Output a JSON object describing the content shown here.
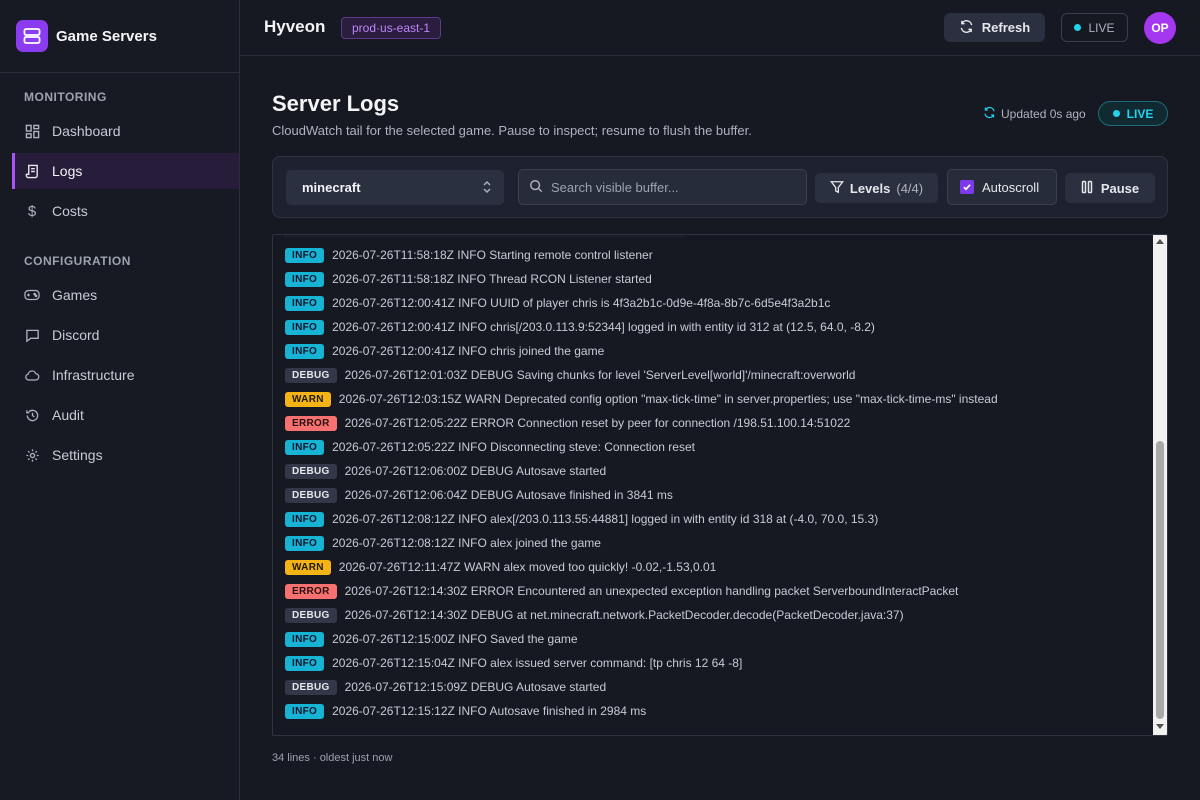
{
  "brand": {
    "name": "Game Servers"
  },
  "sidebar": {
    "sections": [
      {
        "label": "MONITORING"
      },
      {
        "label": "CONFIGURATION"
      }
    ],
    "items": [
      {
        "label": "Dashboard",
        "icon": "dashboard-icon"
      },
      {
        "label": "Logs",
        "icon": "logs-icon",
        "active": true
      },
      {
        "label": "Costs",
        "icon": "dollar-icon"
      },
      {
        "label": "Games",
        "icon": "gamepad-icon"
      },
      {
        "label": "Discord",
        "icon": "chat-icon"
      },
      {
        "label": "Infrastructure",
        "icon": "cloud-icon"
      },
      {
        "label": "Audit",
        "icon": "history-icon"
      },
      {
        "label": "Settings",
        "icon": "gear-icon"
      }
    ]
  },
  "topbar": {
    "title": "Hyveon",
    "env": "prod·us-east-1",
    "refresh_label": "Refresh",
    "live_label": "LIVE",
    "avatar_initials": "OP"
  },
  "header": {
    "title": "Server Logs",
    "subtitle": "CloudWatch tail for the selected game. Pause to inspect; resume to flush the buffer.",
    "updated": "Updated 0s ago",
    "live_label": "LIVE"
  },
  "toolbar": {
    "game": "minecraft",
    "search_placeholder": "Search visible buffer...",
    "levels_label": "Levels",
    "levels_count": "(4/4)",
    "autoscroll_label": "Autoscroll",
    "autoscroll_checked": true,
    "pause_label": "Pause"
  },
  "logs": [
    {
      "level": "INFO",
      "text": "2026-07-26T11:58:18Z INFO Starting remote control listener"
    },
    {
      "level": "INFO",
      "text": "2026-07-26T11:58:18Z INFO Thread RCON Listener started"
    },
    {
      "level": "INFO",
      "text": "2026-07-26T12:00:41Z INFO UUID of player chris is 4f3a2b1c-0d9e-4f8a-8b7c-6d5e4f3a2b1c"
    },
    {
      "level": "INFO",
      "text": "2026-07-26T12:00:41Z INFO chris[/203.0.113.9:52344] logged in with entity id 312 at (12.5, 64.0, -8.2)"
    },
    {
      "level": "INFO",
      "text": "2026-07-26T12:00:41Z INFO chris joined the game"
    },
    {
      "level": "DEBUG",
      "text": "2026-07-26T12:01:03Z DEBUG Saving chunks for level 'ServerLevel[world]'/minecraft:overworld"
    },
    {
      "level": "WARN",
      "text": "2026-07-26T12:03:15Z WARN Deprecated config option \"max-tick-time\" in server.properties; use \"max-tick-time-ms\" instead"
    },
    {
      "level": "ERROR",
      "text": "2026-07-26T12:05:22Z ERROR Connection reset by peer for connection /198.51.100.14:51022"
    },
    {
      "level": "INFO",
      "text": "2026-07-26T12:05:22Z INFO Disconnecting steve: Connection reset"
    },
    {
      "level": "DEBUG",
      "text": "2026-07-26T12:06:00Z DEBUG Autosave started"
    },
    {
      "level": "DEBUG",
      "text": "2026-07-26T12:06:04Z DEBUG Autosave finished in 3841 ms"
    },
    {
      "level": "INFO",
      "text": "2026-07-26T12:08:12Z INFO alex[/203.0.113.55:44881] logged in with entity id 318 at (-4.0, 70.0, 15.3)"
    },
    {
      "level": "INFO",
      "text": "2026-07-26T12:08:12Z INFO alex joined the game"
    },
    {
      "level": "WARN",
      "text": "2026-07-26T12:11:47Z WARN alex moved too quickly! -0.02,-1.53,0.01"
    },
    {
      "level": "ERROR",
      "text": "2026-07-26T12:14:30Z ERROR Encountered an unexpected exception handling packet ServerboundInteractPacket"
    },
    {
      "level": "DEBUG",
      "text": "2026-07-26T12:14:30Z DEBUG   at net.minecraft.network.PacketDecoder.decode(PacketDecoder.java:37)"
    },
    {
      "level": "INFO",
      "text": "2026-07-26T12:15:00Z INFO Saved the game"
    },
    {
      "level": "INFO",
      "text": "2026-07-26T12:15:04Z INFO alex issued server command: [tp chris 12 64 -8]"
    },
    {
      "level": "DEBUG",
      "text": "2026-07-26T12:15:09Z DEBUG Autosave started"
    },
    {
      "level": "INFO",
      "text": "2026-07-26T12:15:12Z INFO Autosave finished in 2984 ms"
    }
  ],
  "footer": {
    "meta": "34 lines · oldest just now"
  }
}
